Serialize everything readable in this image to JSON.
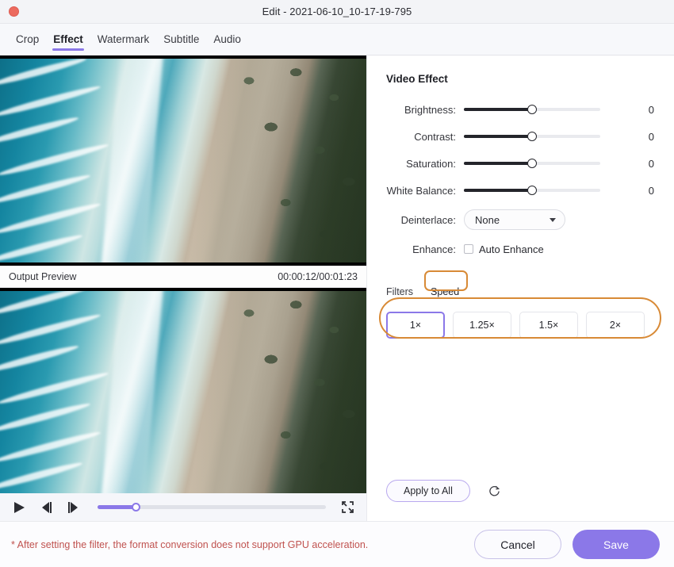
{
  "window": {
    "title": "Edit - 2021-06-10_10-17-19-795",
    "close_icon": "close-dot-icon"
  },
  "tabs": [
    {
      "label": "Crop",
      "active": false
    },
    {
      "label": "Effect",
      "active": true
    },
    {
      "label": "Watermark",
      "active": false
    },
    {
      "label": "Subtitle",
      "active": false
    },
    {
      "label": "Audio",
      "active": false
    }
  ],
  "preview": {
    "label": "Output Preview",
    "timecode": "00:00:12/00:01:23",
    "scene_description": "aerial view of ocean waves, sandy beach and forest"
  },
  "playback": {
    "play_icon": "play-icon",
    "prev_frame_icon": "previous-frame-icon",
    "next_frame_icon": "next-frame-icon",
    "fullscreen_icon": "fullscreen-icon",
    "progress_percent": 17
  },
  "panel": {
    "section_title": "Video Effect",
    "sliders": [
      {
        "label": "Brightness:",
        "value": "0",
        "position": 50
      },
      {
        "label": "Contrast:",
        "value": "0",
        "position": 50
      },
      {
        "label": "Saturation:",
        "value": "0",
        "position": 50
      },
      {
        "label": "White Balance:",
        "value": "0",
        "position": 50
      }
    ],
    "deinterlace": {
      "label": "Deinterlace:",
      "value": "None",
      "chevron_icon": "chevron-down-icon"
    },
    "enhance": {
      "label": "Enhance:",
      "checkbox_label": "Auto Enhance",
      "checked": false
    },
    "filter_tabs": [
      {
        "label": "Filters",
        "active": false
      },
      {
        "label": "Speed",
        "active": true
      }
    ],
    "speeds": [
      {
        "label": "1×",
        "selected": true
      },
      {
        "label": "1.25×",
        "selected": false
      },
      {
        "label": "1.5×",
        "selected": false
      },
      {
        "label": "2×",
        "selected": false
      }
    ],
    "apply_to_all_label": "Apply to All",
    "reset_icon": "reset-icon"
  },
  "footer": {
    "warning": "* After setting the filter, the format conversion does not support GPU acceleration.",
    "cancel_label": "Cancel",
    "save_label": "Save"
  },
  "colors": {
    "accent": "#8b78e8",
    "annotation": "#d88a36",
    "warning": "#c0524f"
  }
}
